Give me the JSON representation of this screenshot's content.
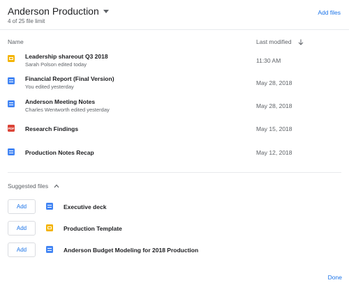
{
  "header": {
    "title": "Anderson Production",
    "subtitle": "4 of 25 file limit",
    "add_files": "Add files"
  },
  "columns": {
    "name": "Name",
    "last_modified": "Last modified"
  },
  "files": [
    {
      "name": "Leadership shareout Q3 2018",
      "sub": "Sarah Polson edited today",
      "date": "11:30 AM",
      "icon": "slides-icon"
    },
    {
      "name": "Financial Report (Final Version)",
      "sub": "You edited yesterday",
      "date": "May 28, 2018",
      "icon": "doc-icon"
    },
    {
      "name": "Anderson Meeting Notes",
      "sub": "Charles Wentworth edited yesterday",
      "date": "May 28, 2018",
      "icon": "doc-icon"
    },
    {
      "name": "Research Findings",
      "sub": "",
      "date": "May 15, 2018",
      "icon": "pdf-icon",
      "icon_text": "PDF"
    },
    {
      "name": "Production Notes Recap",
      "sub": "",
      "date": "May 12, 2018",
      "icon": "doc-icon"
    }
  ],
  "suggested": {
    "label": "Suggested files",
    "add_label": "Add",
    "items": [
      {
        "name": "Executive deck",
        "icon": "doc-icon"
      },
      {
        "name": "Production Template",
        "icon": "slides-icon"
      },
      {
        "name": "Anderson Budget Modeling for 2018 Production",
        "icon": "doc-icon"
      }
    ]
  },
  "footer": {
    "done": "Done"
  },
  "colors": {
    "accent": "#1a73e8",
    "doc": "#4285f4",
    "slides": "#f4b400",
    "pdf": "#db4437"
  }
}
